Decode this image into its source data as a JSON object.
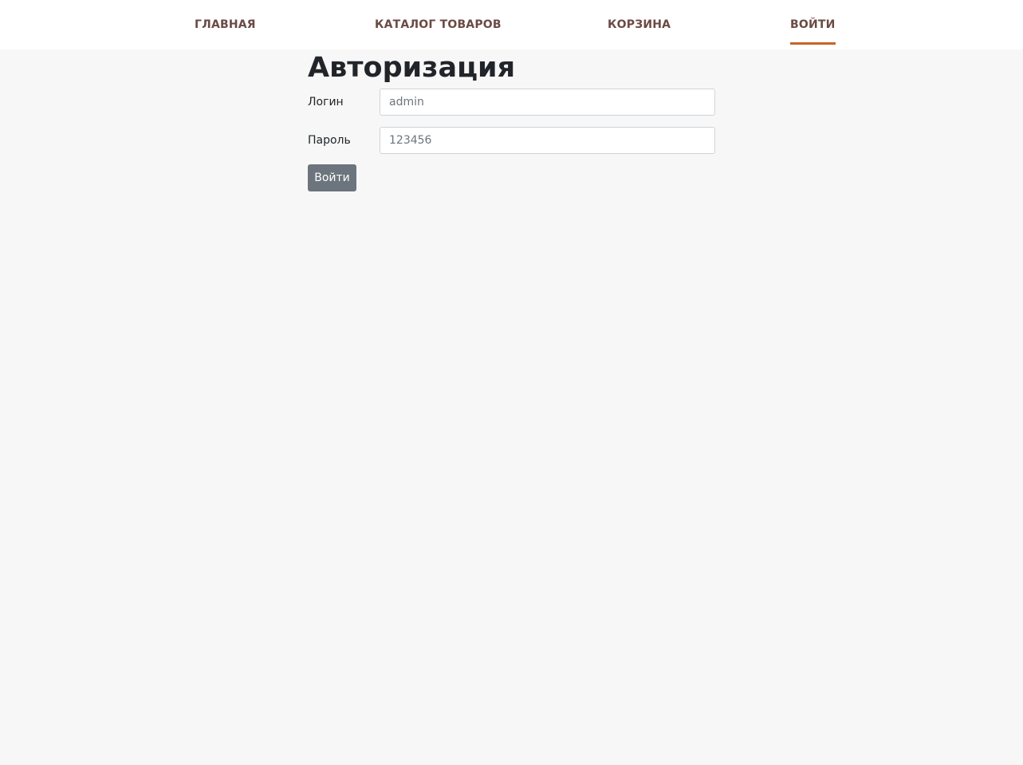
{
  "nav": {
    "items": [
      {
        "label": "ГЛАВНАЯ",
        "active": false
      },
      {
        "label": "КАТАЛОГ ТОВАРОВ",
        "active": false
      },
      {
        "label": "КОРЗИНА",
        "active": false
      },
      {
        "label": "ВОЙТИ",
        "active": true
      }
    ],
    "active_underline_color": "#c8632a",
    "link_color": "#6b4a43"
  },
  "page": {
    "title": "Авторизация"
  },
  "form": {
    "login_label": "Логин",
    "login_placeholder": "admin",
    "password_label": "Пароль",
    "password_placeholder": "123456",
    "submit_label": "Войти",
    "submit_color": "#6c757d"
  }
}
